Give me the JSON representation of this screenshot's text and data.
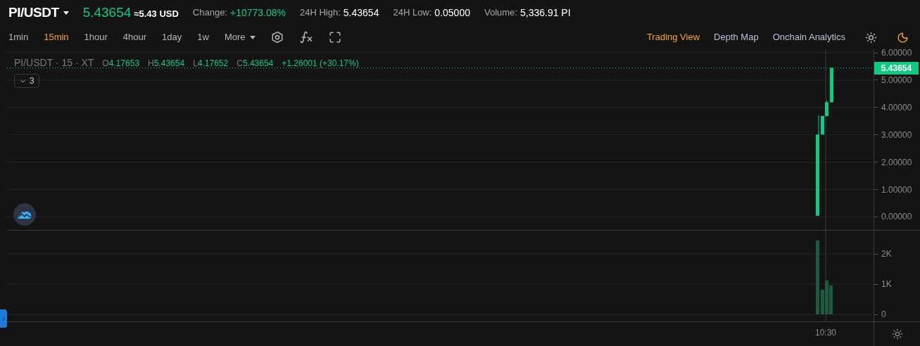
{
  "header": {
    "pair": "PI/USDT",
    "price": "5.43654",
    "approx": "≈5.43 USD",
    "stats": [
      {
        "label": "Change:",
        "value": "+10773.08%",
        "kind": "change"
      },
      {
        "label": "24H High:",
        "value": "5.43654",
        "kind": "plain"
      },
      {
        "label": "24H Low:",
        "value": "0.05000",
        "kind": "plain"
      },
      {
        "label": "Volume:",
        "value": "5,336.91 PI",
        "kind": "plain"
      }
    ]
  },
  "intervals": [
    {
      "label": "1min",
      "selected": false
    },
    {
      "label": "15min",
      "selected": true
    },
    {
      "label": "1hour",
      "selected": false
    },
    {
      "label": "4hour",
      "selected": false
    },
    {
      "label": "1day",
      "selected": false
    },
    {
      "label": "1w",
      "selected": false
    }
  ],
  "more": "More",
  "views": [
    {
      "label": "Trading View",
      "selected": true
    },
    {
      "label": "Depth Map",
      "selected": false
    },
    {
      "label": "Onchain Analytics",
      "selected": false
    }
  ],
  "themes": [
    {
      "kind": "light",
      "selected": false
    },
    {
      "kind": "dark",
      "selected": true
    }
  ],
  "legend": {
    "symbol": "PI/USDT · 15 · XT",
    "values": [
      {
        "key": "O",
        "value": "4.17653"
      },
      {
        "key": "H",
        "value": "5.43654"
      },
      {
        "key": "L",
        "value": "4.17652"
      },
      {
        "key": "C",
        "value": "5.43654"
      }
    ],
    "change": "+1.26001 (+30.17%)"
  },
  "indicator_count": "3",
  "price_axis": [
    "6.00000",
    "5.00000",
    "4.00000",
    "3.00000",
    "2.00000",
    "1.00000",
    "0.00000"
  ],
  "last_price_tag": "5.43654",
  "volume_axis": [
    "2K",
    "1K",
    "0"
  ],
  "time_axis": [
    "10:30"
  ]
}
